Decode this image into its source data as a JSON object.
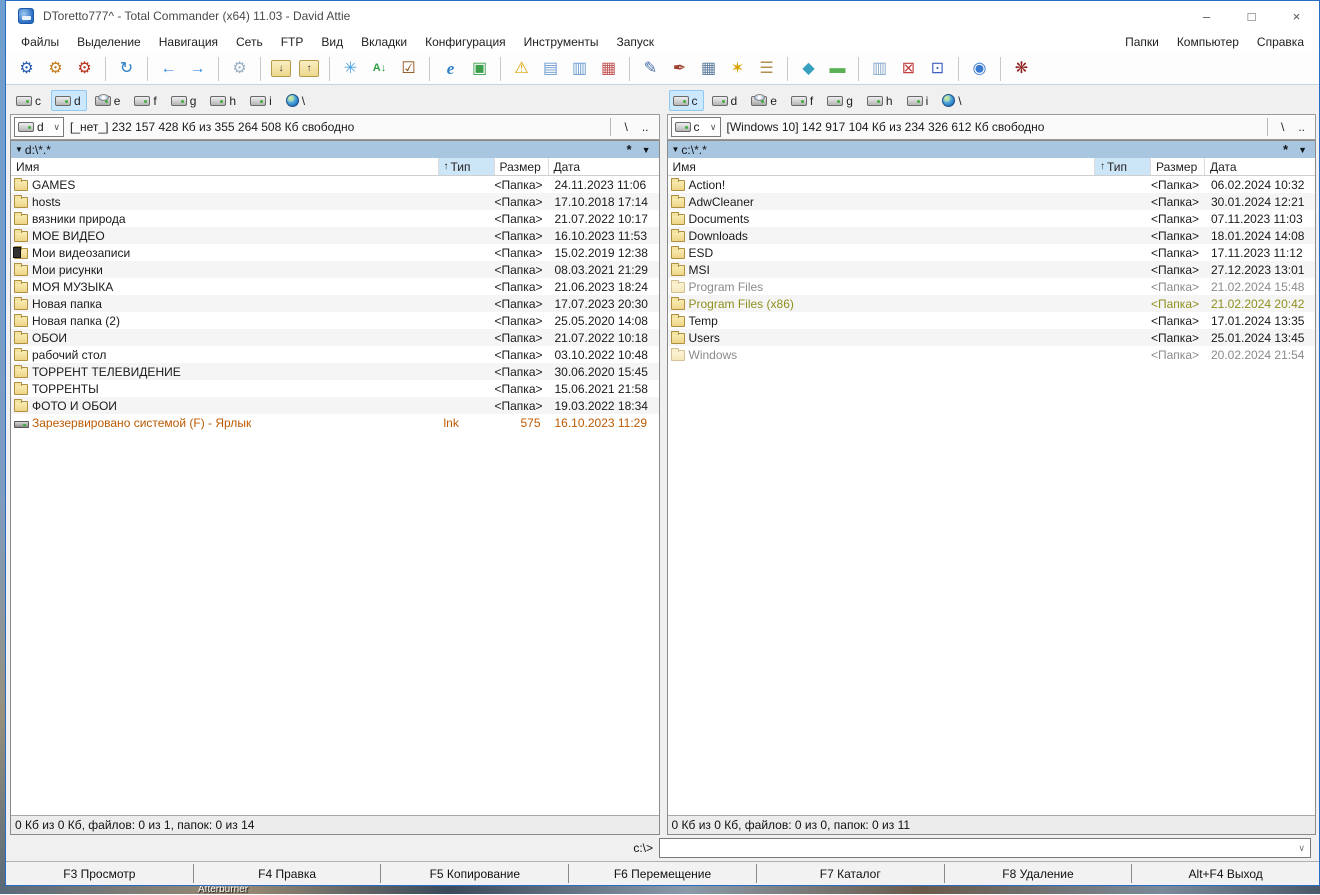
{
  "window": {
    "title": "DToretto777^ - Total Commander (x64) 11.03 - David Attie"
  },
  "icons": {
    "minimize": "–",
    "maximize": "□",
    "close": "×",
    "dropdown": "▼",
    "star": "*",
    "sort_asc": "↑",
    "combo_chevron": "∨",
    "cmd_chevron": "∨"
  },
  "colors": {
    "path_bar": "#a9c6e1",
    "type_header_highlight": "#cde6f7",
    "selected_drive_bg": "#cce8ff",
    "selected_drive_border": "#90c8f0",
    "hidden_text": "#8a8a8a",
    "encrypted_text": "#8f8f1f",
    "link_text": "#bc5a00",
    "window_border": "#2a6cc4"
  },
  "menu": {
    "items": [
      {
        "id": "files",
        "label": "Файлы"
      },
      {
        "id": "selection",
        "label": "Выделение"
      },
      {
        "id": "navigation",
        "label": "Навигация"
      },
      {
        "id": "net",
        "label": "Сеть"
      },
      {
        "id": "ftp",
        "label": "FTP"
      },
      {
        "id": "view",
        "label": "Вид"
      },
      {
        "id": "tabs",
        "label": "Вкладки"
      },
      {
        "id": "configuration",
        "label": "Конфигурация"
      },
      {
        "id": "tools",
        "label": "Инструменты"
      },
      {
        "id": "run",
        "label": "Запуск"
      }
    ],
    "right_items": [
      {
        "id": "folders",
        "label": "Папки"
      },
      {
        "id": "computer",
        "label": "Компьютер"
      },
      {
        "id": "help",
        "label": "Справка"
      }
    ]
  },
  "toolbar": {
    "groups": [
      [
        {
          "name": "settings-gear-blue-icon",
          "glyph": "⚙",
          "color": "#2a5db0"
        },
        {
          "name": "settings-gear-orange-icon",
          "glyph": "⚙",
          "color": "#c27b1b"
        },
        {
          "name": "settings-gear-red-icon",
          "glyph": "⚙",
          "color": "#b8321f"
        }
      ],
      [
        {
          "name": "refresh-icon",
          "glyph": "↻",
          "color": "#2a7ec7"
        }
      ],
      [
        {
          "name": "back-icon",
          "glyph": "←",
          "color": "#3b8ede"
        },
        {
          "name": "forward-icon",
          "glyph": "→",
          "color": "#3b8ede"
        }
      ],
      [
        {
          "name": "gears-gray-icon",
          "glyph": "⚙",
          "color": "#9ab0c4"
        }
      ],
      [
        {
          "name": "pack-files-icon",
          "glyph": "↓",
          "color": "#333333",
          "folderbg": true
        },
        {
          "name": "unpack-files-icon",
          "glyph": "↑",
          "color": "#333333",
          "folderbg": true
        }
      ],
      [
        {
          "name": "snowflake-icon",
          "glyph": "✳",
          "color": "#4aa3e0"
        },
        {
          "name": "sort-az-icon",
          "glyph": "A↓",
          "color": "#2f9e41",
          "small": true
        },
        {
          "name": "verify-checklist-icon",
          "glyph": "☑",
          "color": "#8a4a12"
        }
      ],
      [
        {
          "name": "internet-explorer-icon",
          "glyph": "e",
          "color": "#2a7ec7",
          "italic": true
        },
        {
          "name": "network-computer-icon",
          "glyph": "▣",
          "color": "#3a9e4a"
        }
      ],
      [
        {
          "name": "doc-warning-icon",
          "glyph": "⚠",
          "color": "#d9a300"
        },
        {
          "name": "doc-preview-icon",
          "glyph": "▤",
          "color": "#6a9bd0"
        },
        {
          "name": "doc-properties-icon",
          "glyph": "▥",
          "color": "#6a9bd0"
        },
        {
          "name": "color-tiles-icon",
          "glyph": "▦",
          "color": "#c05050"
        }
      ],
      [
        {
          "name": "notepad-icon",
          "glyph": "✎",
          "color": "#4a6fa5"
        },
        {
          "name": "paint-brushes-icon",
          "glyph": "✒",
          "color": "#a04030"
        },
        {
          "name": "calculator-icon",
          "glyph": "▦",
          "color": "#5a7a9a"
        },
        {
          "name": "new-document-icon",
          "glyph": "✶",
          "color": "#d9a300"
        },
        {
          "name": "script-icon",
          "glyph": "☰",
          "color": "#b09050"
        }
      ],
      [
        {
          "name": "box-3d-icon",
          "glyph": "◆",
          "color": "#3aa0c0"
        },
        {
          "name": "eraser-icon",
          "glyph": "▬",
          "color": "#5ab052"
        }
      ],
      [
        {
          "name": "image-icon",
          "glyph": "▥",
          "color": "#88aacc"
        },
        {
          "name": "image-delete-icon",
          "glyph": "⊠",
          "color": "#c04040"
        },
        {
          "name": "image-search-icon",
          "glyph": "⊡",
          "color": "#4060c0"
        }
      ],
      [
        {
          "name": "cd-disc-icon",
          "glyph": "◉",
          "color": "#3a7ad0"
        }
      ],
      [
        {
          "name": "spray-debug-icon",
          "glyph": "❋",
          "color": "#902020"
        }
      ]
    ]
  },
  "drivebar": {
    "drives": [
      "c",
      "d",
      "e",
      "f",
      "g",
      "h",
      "i"
    ],
    "root_label": "\\"
  },
  "panels": {
    "left": {
      "selected_drive": "d",
      "combo_drive": "d",
      "info": "[_нет_]  232 157 428 Кб из 355 264 508 Кб свободно",
      "root_btn": "\\",
      "up_btn": "..",
      "path": "d:\\*.*",
      "columns": {
        "name": "Имя",
        "type": "Тип",
        "size": "Размер",
        "date": "Дата"
      },
      "rows": [
        {
          "name": "GAMES",
          "type": "",
          "size": "<Папка>",
          "date": "24.11.2023 11:06",
          "icon": "folder",
          "style": "normal"
        },
        {
          "name": "hosts",
          "type": "",
          "size": "<Папка>",
          "date": "17.10.2018 17:14",
          "icon": "folder",
          "style": "normal"
        },
        {
          "name": "вязники природа",
          "type": "",
          "size": "<Папка>",
          "date": "21.07.2022 10:17",
          "icon": "folder",
          "style": "normal"
        },
        {
          "name": "МОЕ ВИДЕО",
          "type": "",
          "size": "<Папка>",
          "date": "16.10.2023 11:53",
          "icon": "folder",
          "style": "normal"
        },
        {
          "name": "Мои видеозаписи",
          "type": "",
          "size": "<Папка>",
          "date": "15.02.2019 12:38",
          "icon": "folder-video",
          "style": "normal"
        },
        {
          "name": "Мои рисунки",
          "type": "",
          "size": "<Папка>",
          "date": "08.03.2021 21:29",
          "icon": "folder",
          "style": "normal"
        },
        {
          "name": "МОЯ МУЗЫКА",
          "type": "",
          "size": "<Папка>",
          "date": "21.06.2023 18:24",
          "icon": "folder",
          "style": "normal"
        },
        {
          "name": "Новая папка",
          "type": "",
          "size": "<Папка>",
          "date": "17.07.2023 20:30",
          "icon": "folder",
          "style": "normal"
        },
        {
          "name": "Новая папка (2)",
          "type": "",
          "size": "<Папка>",
          "date": "25.05.2020 14:08",
          "icon": "folder",
          "style": "normal"
        },
        {
          "name": "ОБОИ",
          "type": "",
          "size": "<Папка>",
          "date": "21.07.2022 10:18",
          "icon": "folder",
          "style": "normal"
        },
        {
          "name": "рабочий стол",
          "type": "",
          "size": "<Папка>",
          "date": "03.10.2022 10:48",
          "icon": "folder",
          "style": "normal"
        },
        {
          "name": "ТОРРЕНТ ТЕЛЕВИДЕНИЕ",
          "type": "",
          "size": "<Папка>",
          "date": "30.06.2020 15:45",
          "icon": "folder",
          "style": "normal"
        },
        {
          "name": "ТОРРЕНТЫ",
          "type": "",
          "size": "<Папка>",
          "date": "15.06.2021 21:58",
          "icon": "folder",
          "style": "normal"
        },
        {
          "name": "ФОТО И ОБОИ",
          "type": "",
          "size": "<Папка>",
          "date": "19.03.2022 18:34",
          "icon": "folder",
          "style": "normal"
        },
        {
          "name": "Зарезервировано системой (F) - Ярлык",
          "type": "lnk",
          "size": "575",
          "date": "16.10.2023 11:29",
          "icon": "hdd",
          "style": "link"
        }
      ],
      "status": "0 Кб из 0 Кб, файлов: 0 из 1, папок: 0 из 14"
    },
    "right": {
      "selected_drive": "c",
      "combo_drive": "c",
      "info": "[Windows 10]  142 917 104 Кб из 234 326 612 Кб свободно",
      "root_btn": "\\",
      "up_btn": "..",
      "path": "c:\\*.*",
      "columns": {
        "name": "Имя",
        "type": "Тип",
        "size": "Размер",
        "date": "Дата"
      },
      "rows": [
        {
          "name": "Action!",
          "type": "",
          "size": "<Папка>",
          "date": "06.02.2024 10:32",
          "icon": "folder",
          "style": "normal"
        },
        {
          "name": "AdwCleaner",
          "type": "",
          "size": "<Папка>",
          "date": "30.01.2024 12:21",
          "icon": "folder",
          "style": "normal"
        },
        {
          "name": "Documents",
          "type": "",
          "size": "<Папка>",
          "date": "07.11.2023 11:03",
          "icon": "folder",
          "style": "normal"
        },
        {
          "name": "Downloads",
          "type": "",
          "size": "<Папка>",
          "date": "18.01.2024 14:08",
          "icon": "folder",
          "style": "normal"
        },
        {
          "name": "ESD",
          "type": "",
          "size": "<Папка>",
          "date": "17.11.2023 11:12",
          "icon": "folder",
          "style": "normal"
        },
        {
          "name": "MSI",
          "type": "",
          "size": "<Папка>",
          "date": "27.12.2023 13:01",
          "icon": "folder",
          "style": "normal"
        },
        {
          "name": "Program Files",
          "type": "",
          "size": "<Папка>",
          "date": "21.02.2024 15:48",
          "icon": "folder",
          "style": "hidden"
        },
        {
          "name": "Program Files (x86)",
          "type": "",
          "size": "<Папка>",
          "date": "21.02.2024 20:42",
          "icon": "folder",
          "style": "olive"
        },
        {
          "name": "Temp",
          "type": "",
          "size": "<Папка>",
          "date": "17.01.2024 13:35",
          "icon": "folder",
          "style": "normal"
        },
        {
          "name": "Users",
          "type": "",
          "size": "<Папка>",
          "date": "25.01.2024 13:45",
          "icon": "folder",
          "style": "normal"
        },
        {
          "name": "Windows",
          "type": "",
          "size": "<Папка>",
          "date": "20.02.2024 21:54",
          "icon": "folder",
          "style": "hidden"
        }
      ],
      "status": "0 Кб из 0 Кб, файлов: 0 из 0, папок: 0 из 11"
    }
  },
  "command_line": {
    "prompt": "c:\\>",
    "value": ""
  },
  "function_keys": [
    {
      "id": "f3-view",
      "label": "F3 Просмотр"
    },
    {
      "id": "f4-edit",
      "label": "F4 Правка"
    },
    {
      "id": "f5-copy",
      "label": "F5 Копирование"
    },
    {
      "id": "f6-move",
      "label": "F6 Перемещение"
    },
    {
      "id": "f7-mkdir",
      "label": "F7 Каталог"
    },
    {
      "id": "f8-delete",
      "label": "F8 Удаление"
    },
    {
      "id": "alt-f4-exit",
      "label": "Alt+F4 Выход"
    }
  ],
  "desktop": {
    "icon_label": "Afterburner"
  }
}
